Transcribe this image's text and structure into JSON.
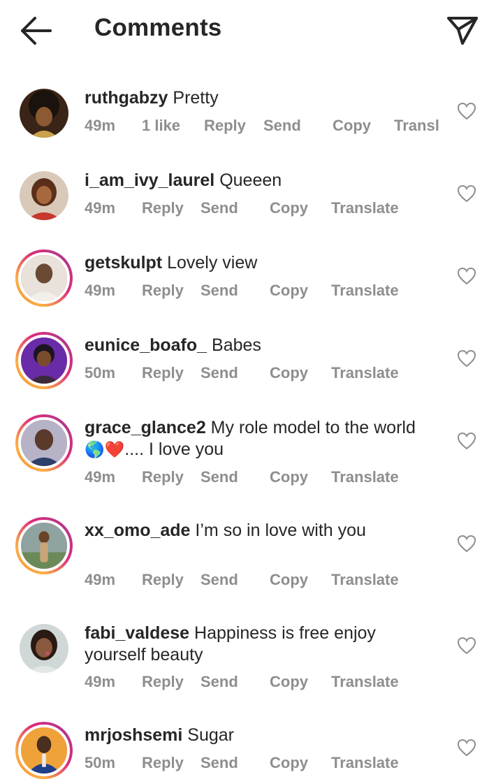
{
  "header": {
    "title": "Comments",
    "back_icon": "arrow-left-icon",
    "send_icon": "paper-plane-icon"
  },
  "colors": {
    "text": "#262626",
    "meta": "#8e8e8e",
    "story_ring": [
      "#f58529",
      "#dd2a7b",
      "#8134af"
    ]
  },
  "comments": [
    {
      "username": "ruthgabzy",
      "text": "Pretty",
      "time": "49m",
      "likes": "1 like",
      "reply": "Reply",
      "send": "Send",
      "copy": "Copy",
      "translate": "Transl"
    },
    {
      "username": "i_am_ivy_laurel",
      "text": "Queeen",
      "time": "49m",
      "reply": "Reply",
      "send": "Send",
      "copy": "Copy",
      "translate": "Translate"
    },
    {
      "username": "getskulpt",
      "text": "Lovely view",
      "time": "49m",
      "reply": "Reply",
      "send": "Send",
      "copy": "Copy",
      "translate": "Translate"
    },
    {
      "username": "eunice_boafo_",
      "text": "Babes",
      "time": "50m",
      "reply": "Reply",
      "send": "Send",
      "copy": "Copy",
      "translate": "Translate"
    },
    {
      "username": "grace_glance2",
      "text": "My role model to the world",
      "text_line2_emoji": "🌎❤️",
      "text_line2": ".... I love you",
      "time": "49m",
      "reply": "Reply",
      "send": "Send",
      "copy": "Copy",
      "translate": "Translate"
    },
    {
      "username": "xx_omo_ade",
      "text": "I’m so in love with you",
      "time": "49m",
      "reply": "Reply",
      "send": "Send",
      "copy": "Copy",
      "translate": "Translate"
    },
    {
      "username": "fabi_valdese",
      "text": "Happiness is free  enjoy",
      "text_line2": "yourself beauty",
      "time": "49m",
      "reply": "Reply",
      "send": "Send",
      "copy": "Copy",
      "translate": "Translate"
    },
    {
      "username": "mrjoshsemi",
      "text": "Sugar",
      "time": "50m",
      "reply": "Reply",
      "send": "Send",
      "copy": "Copy",
      "translate": "Translate"
    }
  ]
}
